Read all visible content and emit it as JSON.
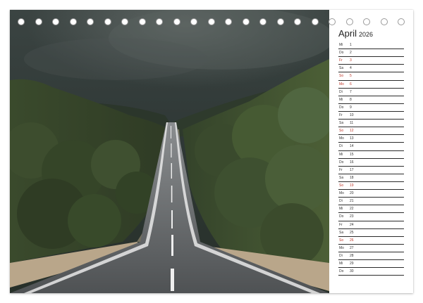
{
  "calendar": {
    "month": "April",
    "year": "2026",
    "days": [
      {
        "wd": "Mi",
        "num": "1",
        "sun": false
      },
      {
        "wd": "Do",
        "num": "2",
        "sun": false
      },
      {
        "wd": "Fr",
        "num": "3",
        "sun": true
      },
      {
        "wd": "Sa",
        "num": "4",
        "sun": false
      },
      {
        "wd": "So",
        "num": "5",
        "sun": true
      },
      {
        "wd": "Mo",
        "num": "6",
        "sun": true
      },
      {
        "wd": "Di",
        "num": "7",
        "sun": false
      },
      {
        "wd": "Mi",
        "num": "8",
        "sun": false
      },
      {
        "wd": "Do",
        "num": "9",
        "sun": false
      },
      {
        "wd": "Fr",
        "num": "10",
        "sun": false
      },
      {
        "wd": "Sa",
        "num": "11",
        "sun": false
      },
      {
        "wd": "So",
        "num": "12",
        "sun": true
      },
      {
        "wd": "Mo",
        "num": "13",
        "sun": false
      },
      {
        "wd": "Di",
        "num": "14",
        "sun": false
      },
      {
        "wd": "Mi",
        "num": "15",
        "sun": false
      },
      {
        "wd": "Do",
        "num": "16",
        "sun": false
      },
      {
        "wd": "Fr",
        "num": "17",
        "sun": false
      },
      {
        "wd": "Sa",
        "num": "18",
        "sun": false
      },
      {
        "wd": "So",
        "num": "19",
        "sun": true
      },
      {
        "wd": "Mo",
        "num": "20",
        "sun": false
      },
      {
        "wd": "Di",
        "num": "21",
        "sun": false
      },
      {
        "wd": "Mi",
        "num": "22",
        "sun": false
      },
      {
        "wd": "Do",
        "num": "23",
        "sun": false
      },
      {
        "wd": "Fr",
        "num": "24",
        "sun": false
      },
      {
        "wd": "Sa",
        "num": "25",
        "sun": false
      },
      {
        "wd": "So",
        "num": "26",
        "sun": true
      },
      {
        "wd": "Mo",
        "num": "27",
        "sun": false
      },
      {
        "wd": "Di",
        "num": "28",
        "sun": false
      },
      {
        "wd": "Mi",
        "num": "29",
        "sun": false
      },
      {
        "wd": "Do",
        "num": "30",
        "sun": false
      }
    ]
  },
  "colors": {
    "holiday_red": "#c0392b",
    "sky": "#2c3331",
    "forest": "#3b4a2c",
    "road": "#5b5d5f"
  }
}
